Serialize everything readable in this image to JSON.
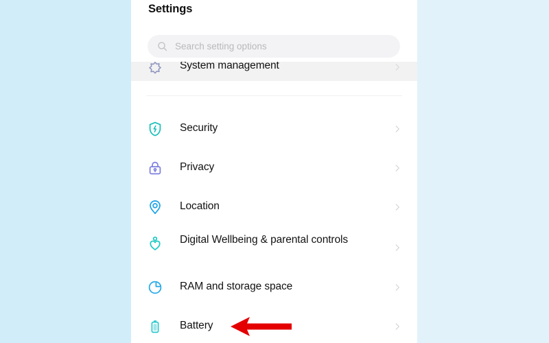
{
  "window": {
    "background_left_color": "#d2edfa",
    "background_right_color": "#e2f2fb",
    "panel_color": "#ffffff"
  },
  "header": {
    "title": "Settings"
  },
  "search": {
    "icon": "search-icon",
    "placeholder": "Search setting options",
    "value": ""
  },
  "list": {
    "partial_top_item": {
      "icon": "system-management-icon",
      "label": "System management",
      "chevron": "chevron-right-icon",
      "highlighted": true
    },
    "items": [
      {
        "icon": "shield-bolt-icon",
        "label": "Security",
        "icon_color": "#16c0bb",
        "chevron": "chevron-right-icon"
      },
      {
        "icon": "lock-icon",
        "label": "Privacy",
        "icon_color": "#7b7ede",
        "chevron": "chevron-right-icon"
      },
      {
        "icon": "location-pin-icon",
        "label": "Location",
        "icon_color": "#17a2e8",
        "chevron": "chevron-right-icon"
      },
      {
        "icon": "wellbeing-heart-person-icon",
        "label": "Digital Wellbeing & parental controls",
        "icon_color": "#18c9c0",
        "chevron": "chevron-right-icon"
      },
      {
        "icon": "pie-chart-icon",
        "label": "RAM and storage space",
        "icon_color": "#20a8e8",
        "chevron": "chevron-right-icon"
      },
      {
        "icon": "battery-icon",
        "label": "Battery",
        "icon_color": "#2ec9cd",
        "chevron": "chevron-right-icon"
      }
    ]
  },
  "annotation": {
    "arrow": "red-arrow-pointing-left",
    "color": "#e00000",
    "points_at": "Battery"
  }
}
